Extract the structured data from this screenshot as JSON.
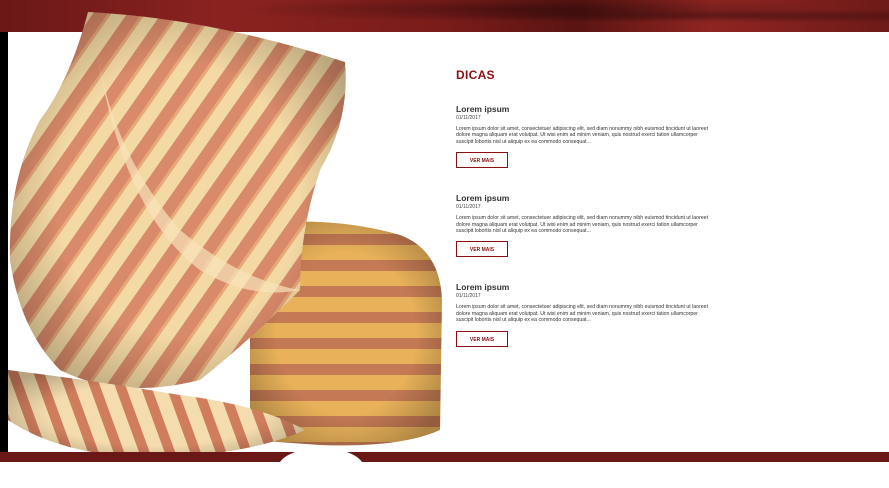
{
  "section": {
    "title": "DICAS"
  },
  "articles": [
    {
      "title": "Lorem ipsum",
      "date": "01/11/2017",
      "text": "Lorem ipsum dolor sit amet, consectetuer adipiscing elit, sed diam nonummy nibh euismod tincidunt ut laoreet dolore magna aliquam erat volutpat. Ut wisi enim ad minim veniam, quis nostrud exerci tation ullamcorper suscipit lobortis nisl ut aliquip ex ea commodo consequat...",
      "button": "VER MAIS"
    },
    {
      "title": "Lorem ipsum",
      "date": "01/11/2017",
      "text": "Lorem ipsum dolor sit amet, consectetuer adipiscing elit, sed diam nonummy nibh euismod tincidunt ut laoreet dolore magna aliquam erat volutpat. Ut wisi enim ad minim veniam, quis nostrud exerci tation ullamcorper suscipit lobortis nisl ut aliquip ex ea commodo consequat...",
      "button": "VER MAIS"
    },
    {
      "title": "Lorem ipsum",
      "date": "01/11/2017",
      "text": "Lorem ipsum dolor sit amet, consectetuer adipiscing elit, sed diam nonummy nibh euismod tincidunt ut laoreet dolore magna aliquam erat volutpat. Ut wisi enim ad minim veniam, quis nostrud exerci tation ullamcorper suscipit lobortis nisl ut aliquip ex ea commodo consequat...",
      "button": "VER MAIS"
    }
  ],
  "colors": {
    "accent": "#8b0e12",
    "banner": "#7a1c1a"
  }
}
